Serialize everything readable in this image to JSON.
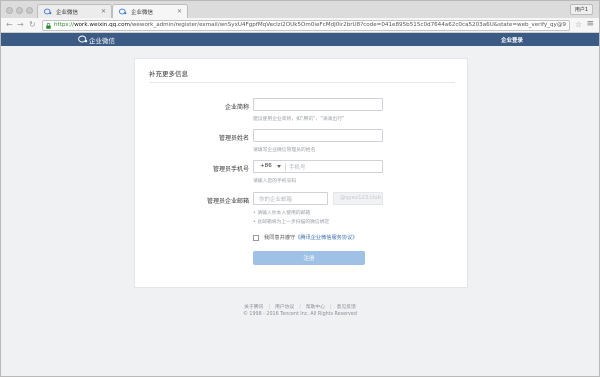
{
  "browser": {
    "tabs": [
      {
        "label": "企业微信"
      },
      {
        "label": "企业微信"
      }
    ],
    "user_button": "用户1",
    "url_scheme": "https://",
    "url_host": "work.weixin.qq.com",
    "url_path": "/wework_admin/register/exmail/wnSyxU4FgpfMqVeclzi2OUk5Om0ieFcMdJ0ir2brU8?code=041e895b515c0d7644a62c0ca5203a6U&state=web_verify_qy@9"
  },
  "site_header": {
    "brand": "企业微信",
    "login": "企业登录",
    "color": "#3b5b85"
  },
  "form": {
    "title": "补充更多信息",
    "company_name": {
      "label": "企业简称",
      "value": "",
      "hint": "建议使用企业简称，如“腾讯”、“滴滴出行”"
    },
    "admin_name": {
      "label": "管理员姓名",
      "value": "",
      "hint": "请填写企业微信管理员的姓名"
    },
    "admin_phone": {
      "label": "管理员手机号",
      "country_code": "+86",
      "placeholder": "手机号",
      "hint": "请输入您的手机号码"
    },
    "admin_email": {
      "label": "管理员企业邮箱",
      "placeholder": "你的企业邮箱",
      "domain_suffix": "@qyex123.club",
      "hints": [
        "请输入你本人使用的邮箱",
        "此邮箱将为上一步扫描的微信绑定"
      ]
    },
    "agreement": {
      "checked": false,
      "prefix": "我同意并遵守",
      "link": "《腾讯企业微信服务协议》"
    },
    "submit_label": "注册",
    "submit_color": "#9fc1e5"
  },
  "footer": {
    "links": [
      "关于腾讯",
      "用户协议",
      "帮助中心",
      "意见反馈"
    ],
    "copyright": "© 1998 - 2016 Tencent Inc. All Rights Reserved"
  }
}
